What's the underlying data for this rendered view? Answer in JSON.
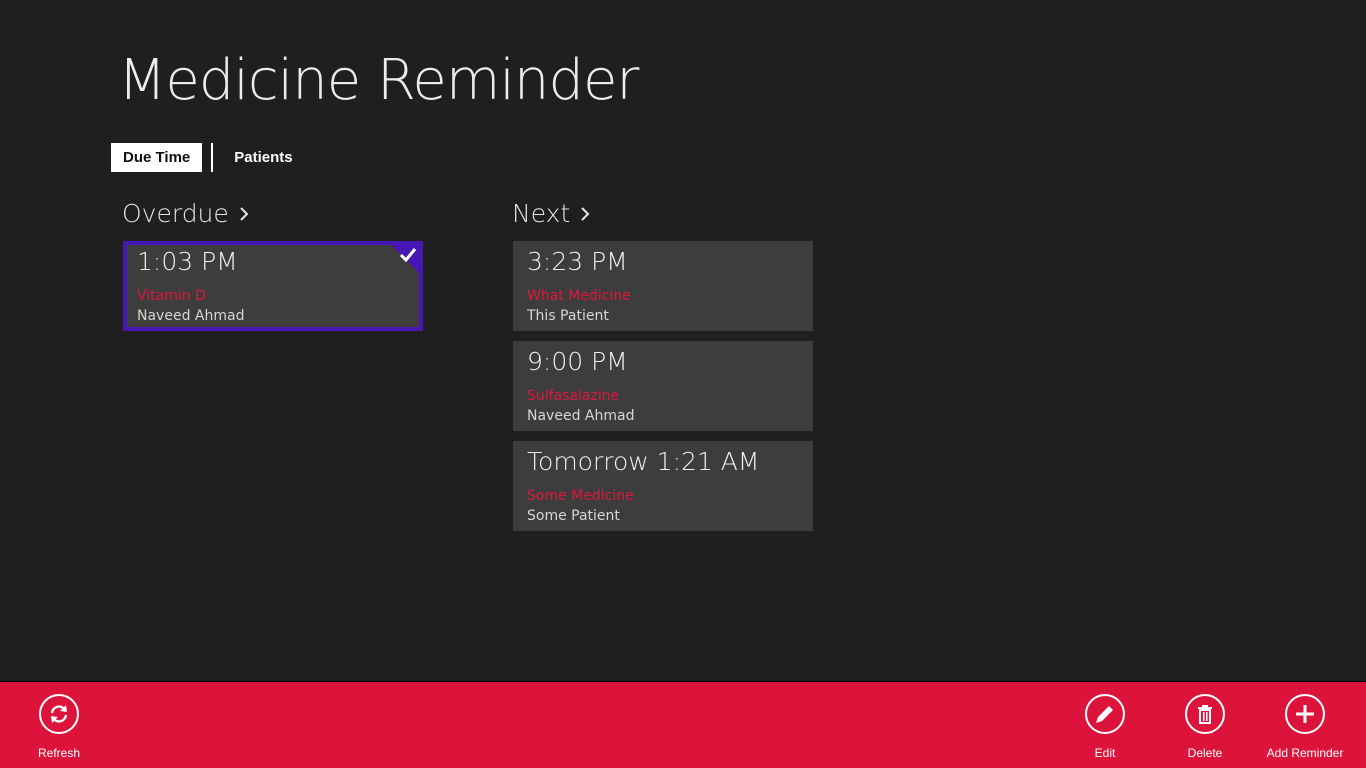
{
  "app": {
    "title": "Medicine Reminder"
  },
  "tabs": [
    {
      "label": "Due Time",
      "active": true
    },
    {
      "label": "Patients",
      "active": false
    }
  ],
  "groups": {
    "overdue": {
      "header": "Overdue",
      "items": [
        {
          "time": "1:03 PM",
          "medicine": "Vitamin D",
          "patient": "Naveed Ahmad",
          "selected": true
        }
      ]
    },
    "next": {
      "header": "Next",
      "items": [
        {
          "time": "3:23 PM",
          "medicine": "What Medicine",
          "patient": "This Patient"
        },
        {
          "time": "9:00 PM",
          "medicine": "Sulfasalazine",
          "patient": "Naveed Ahmad"
        },
        {
          "time": "Tomorrow 1:21 AM",
          "medicine": "Some Medicine",
          "patient": "Some Patient"
        }
      ]
    }
  },
  "appbar": {
    "refresh": {
      "label": "Refresh",
      "icon": "refresh-icon"
    },
    "edit": {
      "label": "Edit",
      "icon": "pencil-icon"
    },
    "delete": {
      "label": "Delete",
      "icon": "trash-icon"
    },
    "add": {
      "label": "Add Reminder",
      "icon": "plus-icon"
    }
  },
  "colors": {
    "background": "#1f1f1f",
    "accent": "#dc143c",
    "selection": "#4617b4",
    "card": "#3d3d3d"
  }
}
